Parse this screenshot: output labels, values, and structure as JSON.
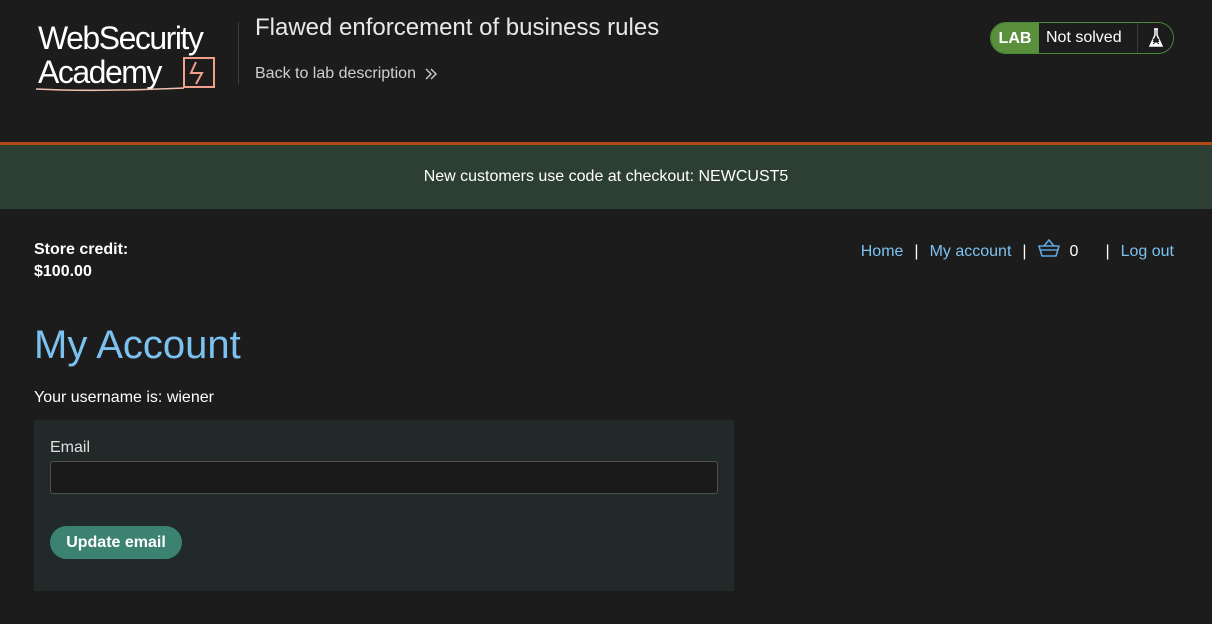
{
  "header": {
    "logo_alt": "Web Security Academy",
    "lab_title": "Flawed enforcement of business rules",
    "back_link": "Back to lab description",
    "lab_badge": "LAB",
    "lab_state": "Not solved"
  },
  "notification": {
    "text": "New customers use code at checkout: NEWCUST5"
  },
  "account": {
    "store_credit_label": "Store credit:",
    "store_credit_value": "$100.00"
  },
  "nav": {
    "home": "Home",
    "my_account": "My account",
    "cart_count": "0",
    "logout": "Log out",
    "separator": "|"
  },
  "main": {
    "title": "My Account",
    "username_line": "Your username is: wiener",
    "email_label": "Email",
    "email_value": "",
    "update_button": "Update email"
  },
  "colors": {
    "background": "#1c1c1c",
    "accent_link": "#7cc2f0",
    "banner_bg": "#2d3e33",
    "banner_border": "#b34716",
    "lab_badge": "#5a8f3c",
    "button": "#3b8370",
    "panel": "#212929"
  },
  "icons": {
    "logo": "web-security-academy-logo",
    "back": "double-chevron-right-icon",
    "flask": "flask-icon",
    "cart": "shopping-basket-icon"
  }
}
